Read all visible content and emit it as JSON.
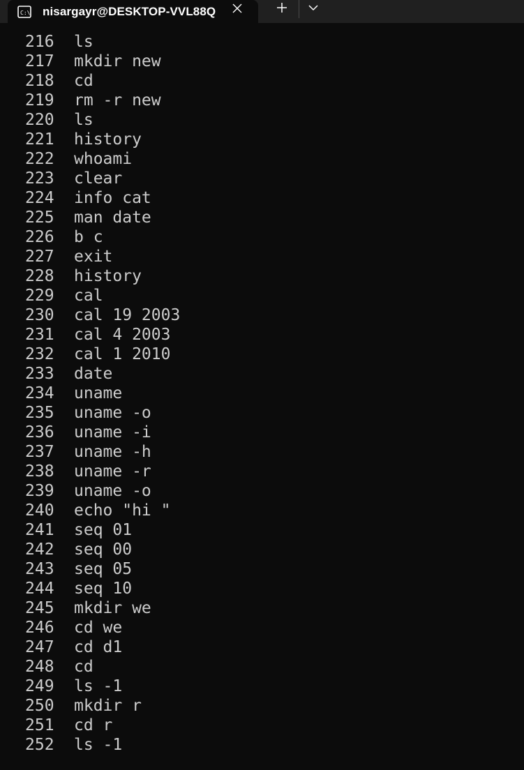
{
  "window": {
    "tab_title": "nisargayr@DESKTOP-VVL88Q",
    "tab_icon": "terminal-icon",
    "close_icon": "close-icon",
    "new_tab_icon": "plus-icon",
    "dropdown_icon": "chevron-down-icon"
  },
  "colors": {
    "background": "#0c0c0c",
    "tabbar": "#202020",
    "text": "#cccccc"
  },
  "history": [
    {
      "num": "216",
      "cmd": "ls"
    },
    {
      "num": "217",
      "cmd": "mkdir new"
    },
    {
      "num": "218",
      "cmd": "cd"
    },
    {
      "num": "219",
      "cmd": "rm -r new"
    },
    {
      "num": "220",
      "cmd": "ls"
    },
    {
      "num": "221",
      "cmd": "history"
    },
    {
      "num": "222",
      "cmd": "whoami"
    },
    {
      "num": "223",
      "cmd": "clear"
    },
    {
      "num": "224",
      "cmd": "info cat"
    },
    {
      "num": "225",
      "cmd": "man date"
    },
    {
      "num": "226",
      "cmd": "b c"
    },
    {
      "num": "227",
      "cmd": "exit"
    },
    {
      "num": "228",
      "cmd": "history"
    },
    {
      "num": "229",
      "cmd": "cal"
    },
    {
      "num": "230",
      "cmd": "cal 19 2003"
    },
    {
      "num": "231",
      "cmd": "cal 4 2003"
    },
    {
      "num": "232",
      "cmd": "cal 1 2010"
    },
    {
      "num": "233",
      "cmd": "date"
    },
    {
      "num": "234",
      "cmd": "uname"
    },
    {
      "num": "235",
      "cmd": "uname -o"
    },
    {
      "num": "236",
      "cmd": "uname -i"
    },
    {
      "num": "237",
      "cmd": "uname -h"
    },
    {
      "num": "238",
      "cmd": "uname -r"
    },
    {
      "num": "239",
      "cmd": "uname -o"
    },
    {
      "num": "240",
      "cmd": "echo \"hi \""
    },
    {
      "num": "241",
      "cmd": "seq 01"
    },
    {
      "num": "242",
      "cmd": "seq 00"
    },
    {
      "num": "243",
      "cmd": "seq 05"
    },
    {
      "num": "244",
      "cmd": "seq 10"
    },
    {
      "num": "245",
      "cmd": "mkdir we"
    },
    {
      "num": "246",
      "cmd": "cd we"
    },
    {
      "num": "247",
      "cmd": "cd d1"
    },
    {
      "num": "248",
      "cmd": "cd"
    },
    {
      "num": "249",
      "cmd": "ls -1"
    },
    {
      "num": "250",
      "cmd": "mkdir r"
    },
    {
      "num": "251",
      "cmd": "cd r"
    },
    {
      "num": "252",
      "cmd": "ls -1"
    }
  ]
}
